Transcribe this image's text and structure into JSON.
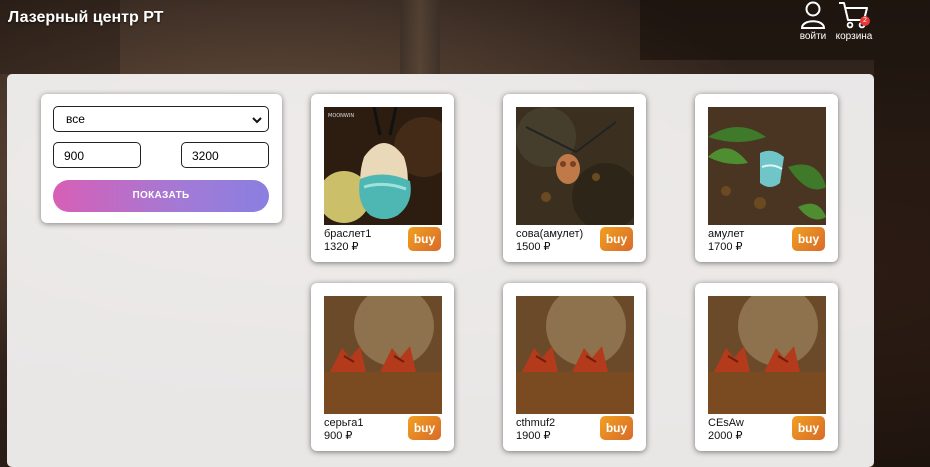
{
  "header": {
    "title": "Лазерный центр РТ",
    "login_label": "войти",
    "cart_label": "корзина",
    "cart_count": "2"
  },
  "filter": {
    "category": "все",
    "price_from": "900",
    "price_to": "3200",
    "show_label": "ПОКАЗАТЬ"
  },
  "products": [
    {
      "name": "браслет1",
      "price": "1320 ₽",
      "buy_label": "buy",
      "image": "teal-resin-pendant"
    },
    {
      "name": "сова(амулет)",
      "price": "1500 ₽",
      "buy_label": "buy",
      "image": "owl-amulet"
    },
    {
      "name": "амулет",
      "price": "1700 ₽",
      "buy_label": "buy",
      "image": "fern-amulet"
    },
    {
      "name": "серьга1",
      "price": "900 ₽",
      "buy_label": "buy",
      "image": "fox-earrings"
    },
    {
      "name": "cthmuf2",
      "price": "1900 ₽",
      "buy_label": "buy",
      "image": "fox-earrings"
    },
    {
      "name": "CEsAw",
      "price": "2000 ₽",
      "buy_label": "buy",
      "image": "fox-earrings"
    }
  ],
  "image_caption": "MOONWIN",
  "colors": {
    "accent_gradient_start": "#d75fb6",
    "accent_gradient_end": "#8a7fe0",
    "buy_button": "#e6872a",
    "badge": "#e53935"
  }
}
